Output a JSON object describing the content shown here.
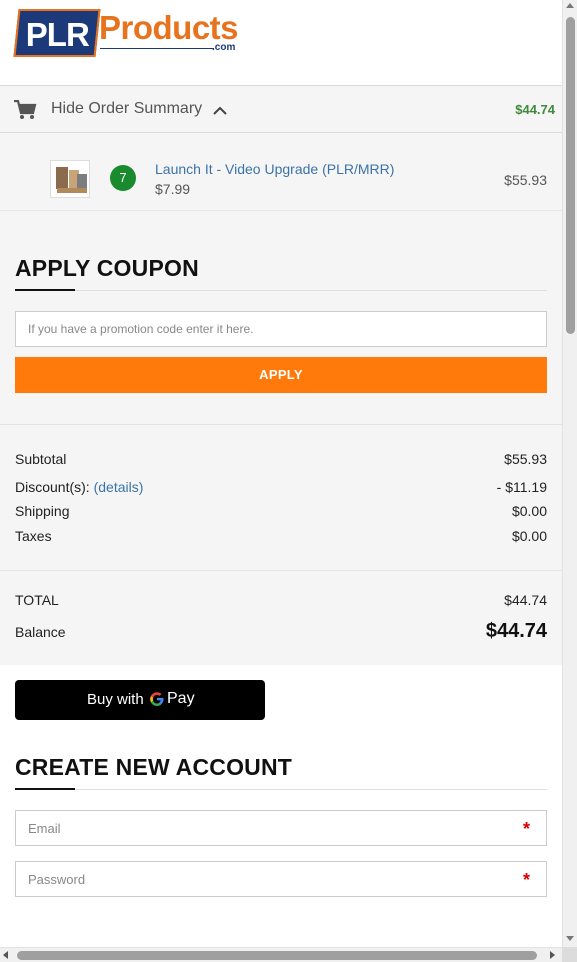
{
  "brand": {
    "logo_plr": "PLR",
    "logo_products": "Products",
    "logo_com": ".com"
  },
  "summary": {
    "toggle_label": "Hide Order Summary",
    "total": "$44.74",
    "icons": {
      "cart": "cart-icon",
      "chevron": "chevron-up-icon"
    },
    "total_color": "#3d8c3d"
  },
  "order_items": [
    {
      "quantity": "7",
      "name": "Launch It - Video Upgrade (PLR/MRR)",
      "unit_price": "$7.99",
      "line_total": "$55.93"
    }
  ],
  "coupon": {
    "title": "APPLY COUPON",
    "placeholder": "If you have a promotion code enter it here.",
    "apply_label": "APPLY",
    "button_color": "#ff7a0a"
  },
  "totals": {
    "subtotal_label": "Subtotal",
    "subtotal_value": "$55.93",
    "discount_label": "Discount(s):",
    "discount_link": "(details)",
    "discount_value": "- $11.19",
    "shipping_label": "Shipping",
    "shipping_value": "$0.00",
    "taxes_label": "Taxes",
    "taxes_value": "$0.00",
    "total_label": "TOTAL",
    "total_value": "$44.74",
    "balance_label": "Balance",
    "balance_value": "$44.74"
  },
  "gpay": {
    "prefix": "Buy with",
    "pay": "Pay"
  },
  "account": {
    "title": "CREATE NEW ACCOUNT",
    "email_placeholder": "Email",
    "password_placeholder": "Password",
    "required_marker": "*"
  }
}
